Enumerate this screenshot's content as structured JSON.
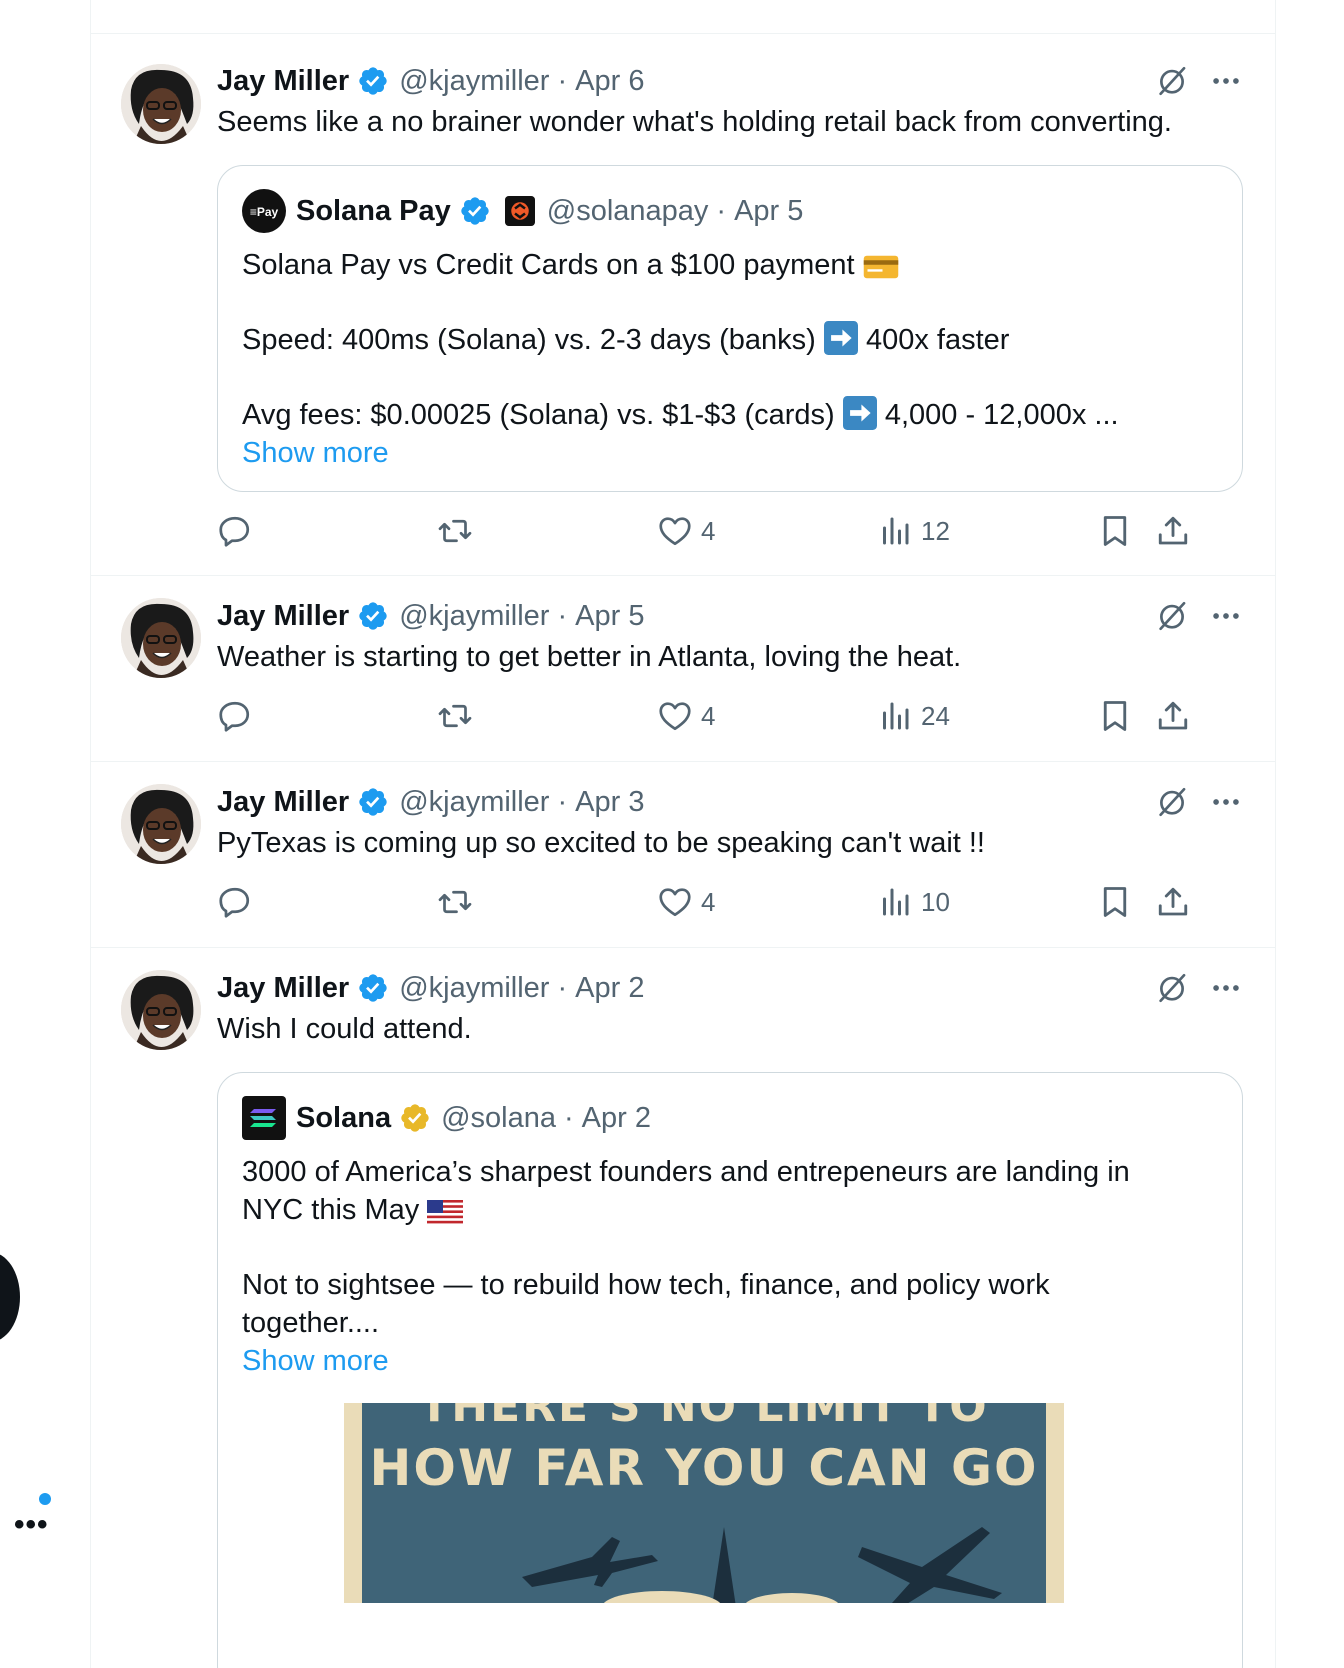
{
  "tweets": [
    {
      "name": "Jay Miller",
      "handle": "@kjaymiller",
      "date": "Apr 6",
      "text": "Seems like a no brainer wonder what's holding retail back from converting.",
      "quote": {
        "name": "Solana Pay",
        "handle": "@solanapay",
        "date": "Apr 5",
        "avatar_label": "≡Pay",
        "line1": "Solana Pay vs Credit Cards on a $100 payment",
        "line2": "Speed: 400ms (Solana) vs. 2-3 days (banks)",
        "line2_end": "400x faster",
        "line3": "Avg fees: $0.00025 (Solana) vs. $1-$3 (cards)",
        "line3_end": "4,000 - 12,000x ...",
        "show_more": "Show more"
      },
      "likes": "4",
      "views": "12"
    },
    {
      "name": "Jay Miller",
      "handle": "@kjaymiller",
      "date": "Apr 5",
      "text": "Weather is starting to get better in Atlanta, loving the heat.",
      "likes": "4",
      "views": "24"
    },
    {
      "name": "Jay Miller",
      "handle": "@kjaymiller",
      "date": "Apr 3",
      "text": "PyTexas is coming up so excited to be speaking can't wait !!",
      "likes": "4",
      "views": "10"
    },
    {
      "name": "Jay Miller",
      "handle": "@kjaymiller",
      "date": "Apr 2",
      "text": "Wish I could attend.",
      "quote": {
        "name": "Solana",
        "handle": "@solana",
        "date": "Apr 2",
        "line1": "3000 of America’s sharpest founders and entrepeneurs are landing in",
        "line2": "NYC this May",
        "line3": "Not to sightsee — to rebuild how tech, finance, and policy work",
        "line4": "together....",
        "show_more": "Show more",
        "poster_line1": "THERE’S NO LIMIT TO",
        "poster_line2": "HOW FAR YOU CAN GO"
      }
    }
  ],
  "colors": {
    "accent": "#1d9bf0",
    "text": "#0f1419",
    "muted": "#536471",
    "border": "#eff3f4",
    "gold_badge": "#e8b829"
  },
  "icons": [
    "verified-badge-icon",
    "grok-icon",
    "more-icon",
    "reply-icon",
    "repost-icon",
    "like-icon",
    "views-icon",
    "bookmark-icon",
    "share-icon"
  ],
  "sidebar": {
    "more_label": "•••"
  }
}
